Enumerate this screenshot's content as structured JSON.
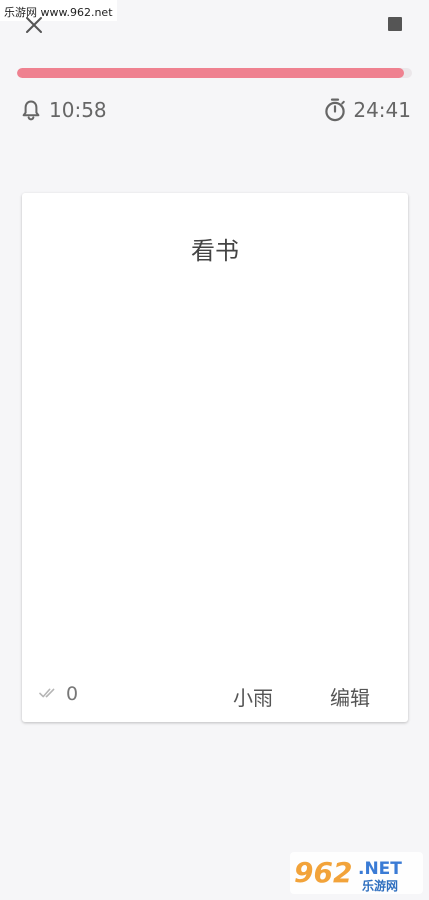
{
  "watermark": {
    "top_text": "乐游网 www.962.net",
    "logo_number": "962",
    "logo_suffix": ".NET",
    "logo_sub": "乐游网"
  },
  "toolbar": {
    "close_icon": "close-icon",
    "stop_icon": "stop-icon"
  },
  "progress": {
    "fraction": 0.98,
    "fill_color": "#ef8190",
    "track_color": "#ebe7ea"
  },
  "reminder": {
    "icon": "bell-icon",
    "time": "10:58"
  },
  "timer": {
    "icon": "stopwatch-icon",
    "time": "24:41"
  },
  "card": {
    "title": "看书",
    "done_icon": "double-check-icon",
    "done_count": "0",
    "owner": "小雨",
    "edit_label": "编辑"
  },
  "colors": {
    "background": "#f6f6f8",
    "card": "#ffffff",
    "accent": "#ef8190"
  }
}
